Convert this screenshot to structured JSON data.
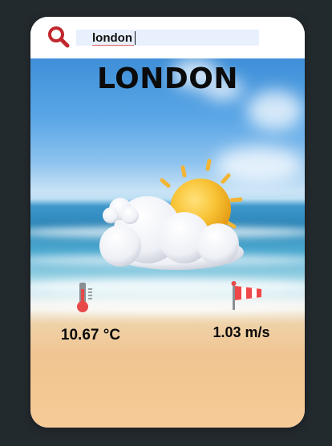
{
  "search": {
    "value": "london",
    "icon": "search-icon"
  },
  "weather": {
    "city": "LONDON",
    "condition_icon": "sun-behind-cloud-icon",
    "temperature": "10.67 °C",
    "temperature_icon": "thermometer-icon",
    "wind_speed": "1.03 m/s",
    "wind_icon": "windsock-icon"
  },
  "colors": {
    "search_icon": "#c0282d",
    "input_background": "#e8f0fe",
    "page_background": "#232a2e"
  }
}
